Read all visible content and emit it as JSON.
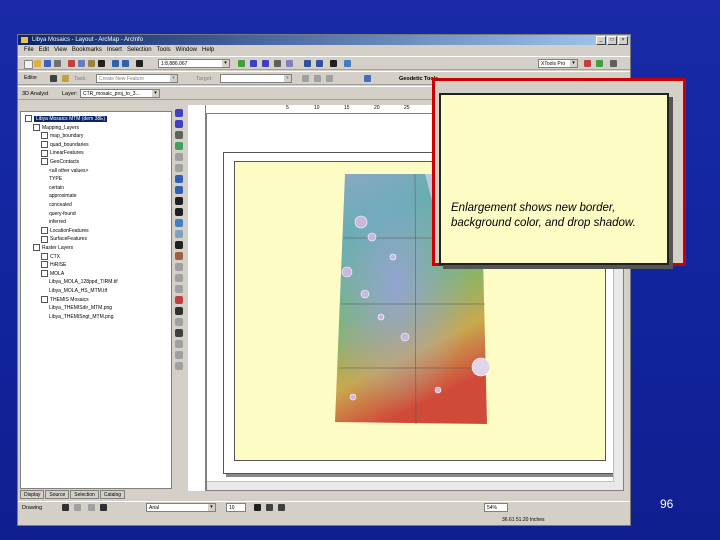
{
  "window": {
    "title": "Libya Mosaics - Layout - ArcMap - ArcInfo"
  },
  "menu": [
    "File",
    "Edit",
    "View",
    "Bookmarks",
    "Insert",
    "Selection",
    "Tools",
    "Window",
    "Help"
  ],
  "toolbar1": {
    "scale": "1:8,886,067",
    "xtools": "XTools Pro"
  },
  "toolbar2": {
    "editor": "Editor",
    "task": "Create New Feature",
    "target": "Target:",
    "geodetic": "Geodetic Tools"
  },
  "toolbar3": {
    "analyst": "3D Analyst",
    "layer_label": "Layer:",
    "layer": "CTR_mosaic_proj_to_3..."
  },
  "toc": {
    "items": [
      {
        "label": "Libya Mosaics MTM (dem 38E)",
        "indent": 0,
        "selected": true
      },
      {
        "label": "Mapping_Layers",
        "indent": 1
      },
      {
        "label": "map_boundary",
        "indent": 2
      },
      {
        "label": "quad_boundaries",
        "indent": 2
      },
      {
        "label": "LinearFeatures",
        "indent": 2
      },
      {
        "label": "GeoContacts",
        "indent": 2
      },
      {
        "label": "<all other values>",
        "indent": 3
      },
      {
        "label": "TYPE",
        "indent": 3
      },
      {
        "label": "certain",
        "indent": 3
      },
      {
        "label": "approximate",
        "indent": 3
      },
      {
        "label": "concealed",
        "indent": 3
      },
      {
        "label": "query-found",
        "indent": 3
      },
      {
        "label": "inferred",
        "indent": 3
      },
      {
        "label": "LocationFeatures",
        "indent": 2
      },
      {
        "label": "SurfaceFeatures",
        "indent": 2
      },
      {
        "label": "Raster Layers",
        "indent": 1
      },
      {
        "label": "CTX",
        "indent": 2
      },
      {
        "label": "HiRISE",
        "indent": 2
      },
      {
        "label": "MOLA",
        "indent": 2
      },
      {
        "label": "Libya_MOLA_128ppd_TIRM.tif",
        "indent": 3
      },
      {
        "label": "Libya_MOLA_HS_MTM.tif",
        "indent": 3
      },
      {
        "label": "THEMIS Mosaics",
        "indent": 2
      },
      {
        "label": "Libya_THEMISdir_MTM.png",
        "indent": 3
      },
      {
        "label": "Libya_THEMISngt_MTM.png",
        "indent": 3
      }
    ],
    "tabs": [
      "Display",
      "Source",
      "Selection",
      "Catalog"
    ]
  },
  "ruler": [
    "5",
    "10",
    "15",
    "20",
    "25",
    "30"
  ],
  "drawing": {
    "label": "Drawing",
    "font": "Arial",
    "size": "10"
  },
  "status": {
    "zoom": "54%",
    "coords": "36.61  51.20 Inches"
  },
  "callout": {
    "text": "Enlargement shows new border, background color, and drop shadow."
  },
  "slide_number": "96",
  "colors": {
    "slide_bg": "#1326a0",
    "callout_border": "#cc0000",
    "map_bg": "#fdfcc4"
  }
}
